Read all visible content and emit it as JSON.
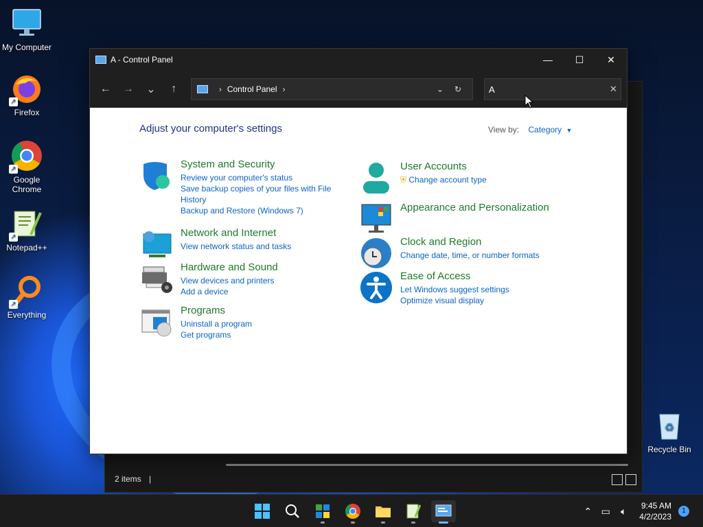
{
  "desktop": {
    "icons": [
      {
        "label": "My Computer"
      },
      {
        "label": "Firefox"
      },
      {
        "label": "Google Chrome"
      },
      {
        "label": "Notepad++"
      },
      {
        "label": "Everything"
      },
      {
        "label": "Recycle Bin"
      }
    ]
  },
  "background_window": {
    "status_count": "2 items",
    "status_sep": "|"
  },
  "window": {
    "title": "A - Control Panel",
    "minimize": "—",
    "maximize": "☐",
    "close": "✕"
  },
  "nav": {
    "back": "←",
    "forward": "→",
    "recent": "⌄",
    "up": "↑",
    "breadcrumb": [
      "Control Panel"
    ],
    "refresh": "↻",
    "search_value": "A",
    "search_clear": "✕"
  },
  "content": {
    "heading": "Adjust your computer's settings",
    "view_by_label": "View by:",
    "view_by_value": "Category",
    "categories_left": [
      {
        "title": "System and Security",
        "links": [
          "Review your computer's status",
          "Save backup copies of your files with File History",
          "Backup and Restore (Windows 7)"
        ]
      },
      {
        "title": "Network and Internet",
        "links": [
          "View network status and tasks"
        ]
      },
      {
        "title": "Hardware and Sound",
        "links": [
          "View devices and printers",
          "Add a device"
        ]
      },
      {
        "title": "Programs",
        "links": [
          "Uninstall a program",
          "Get programs"
        ]
      }
    ],
    "categories_right": [
      {
        "title": "User Accounts",
        "links": [
          "Change account type"
        ]
      },
      {
        "title": "Appearance and Personalization",
        "links": []
      },
      {
        "title": "Clock and Region",
        "links": [
          "Change date, time, or number formats"
        ]
      },
      {
        "title": "Ease of Access",
        "links": [
          "Let Windows suggest settings",
          "Optimize visual display"
        ]
      }
    ]
  },
  "taskbar": {
    "time": "9:45 AM",
    "date": "4/2/2023",
    "notification_count": "1",
    "colors": {
      "accent": "#6db8ff",
      "link": "#0b63c5",
      "category_title": "#1e7a2a",
      "heading": "#1e3287"
    }
  }
}
